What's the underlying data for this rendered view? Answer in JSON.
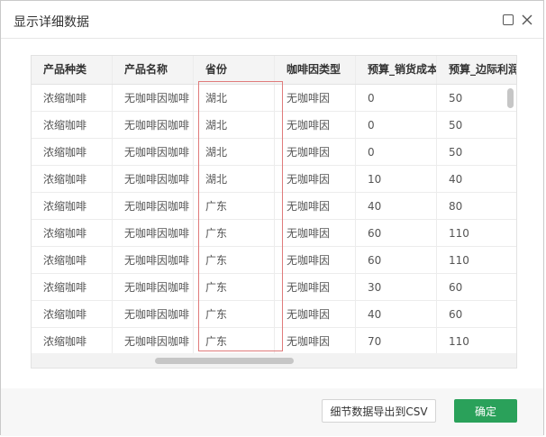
{
  "dialog": {
    "title": "显示详细数据",
    "maximize_icon": "square-icon",
    "close_icon": "close-icon"
  },
  "table": {
    "columns": [
      "产品种类",
      "产品名称",
      "省份",
      "咖啡因类型",
      "预算_销货成本",
      "预算_边际利润"
    ],
    "rows": [
      [
        "浓缩咖啡",
        "无咖啡因咖啡",
        "湖北",
        "无咖啡因",
        "0",
        "50"
      ],
      [
        "浓缩咖啡",
        "无咖啡因咖啡",
        "湖北",
        "无咖啡因",
        "0",
        "50"
      ],
      [
        "浓缩咖啡",
        "无咖啡因咖啡",
        "湖北",
        "无咖啡因",
        "0",
        "50"
      ],
      [
        "浓缩咖啡",
        "无咖啡因咖啡",
        "湖北",
        "无咖啡因",
        "10",
        "40"
      ],
      [
        "浓缩咖啡",
        "无咖啡因咖啡",
        "广东",
        "无咖啡因",
        "40",
        "80"
      ],
      [
        "浓缩咖啡",
        "无咖啡因咖啡",
        "广东",
        "无咖啡因",
        "60",
        "110"
      ],
      [
        "浓缩咖啡",
        "无咖啡因咖啡",
        "广东",
        "无咖啡因",
        "60",
        "110"
      ],
      [
        "浓缩咖啡",
        "无咖啡因咖啡",
        "广东",
        "无咖啡因",
        "30",
        "60"
      ],
      [
        "浓缩咖啡",
        "无咖啡因咖啡",
        "广东",
        "无咖啡因",
        "40",
        "60"
      ],
      [
        "浓缩咖啡",
        "无咖啡因咖啡",
        "广东",
        "无咖啡因",
        "70",
        "110"
      ]
    ]
  },
  "footer": {
    "export_label": "细节数据导出到CSV",
    "ok_label": "确定"
  },
  "colors": {
    "accent": "#2aa15a",
    "highlight": "#e07b7b"
  }
}
